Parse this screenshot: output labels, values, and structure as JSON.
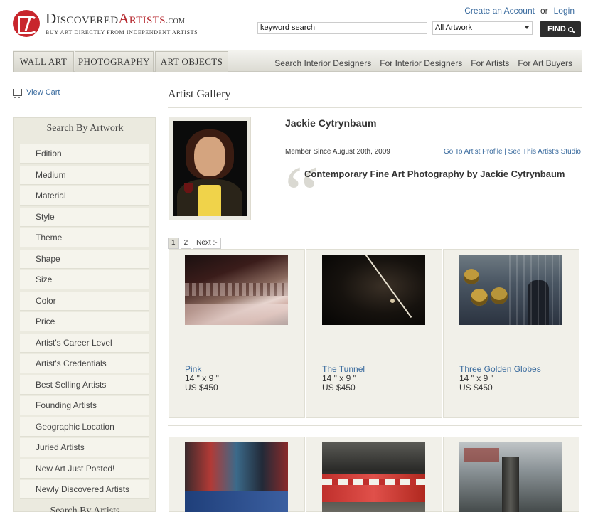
{
  "header": {
    "logo_prefix": "Discovered",
    "logo_accent": "Artists",
    "logo_suffix": ".com",
    "tagline": "BUY ART DIRECTLY FROM INDEPENDENT ARTISTS",
    "create_account": "Create an Account",
    "or": "or",
    "login": "Login",
    "search_value": "keyword search",
    "category_select": "All Artwork",
    "find_label": "FIND"
  },
  "nav": {
    "tabs": [
      "WALL ART",
      "PHOTOGRAPHY",
      "ART OBJECTS"
    ],
    "links": [
      "Search Interior Designers",
      "For Interior Designers",
      "For Artists",
      "For Art Buyers"
    ]
  },
  "sidebar": {
    "view_cart": "View Cart",
    "heading": "Search By Artwork",
    "items": [
      "Edition",
      "Medium",
      "Material",
      "Style",
      "Theme",
      "Shape",
      "Size",
      "Color",
      "Price",
      "Artist's Career Level",
      "Artist's Credentials",
      "Best Selling Artists",
      "Founding Artists",
      "Geographic Location",
      "Juried Artists",
      "New Art Just Posted!",
      "Newly Discovered Artists"
    ],
    "heading2": "Search By Artists"
  },
  "main": {
    "title": "Artist Gallery",
    "artist_name": "Jackie Cytrynbaum",
    "member_since": "Member Since August 20th, 2009",
    "profile_links": "Go To Artist Profile | See This Artist's Studio",
    "statement": "Contemporary Fine Art Photography by Jackie Cytrynbaum",
    "quote_mark": "“",
    "pager": [
      "1",
      "2",
      "Next :-"
    ],
    "artworks": [
      {
        "title": "Pink",
        "size": "14 \" x 9 \"",
        "price": "US $450"
      },
      {
        "title": "The Tunnel",
        "size": "14 \" x 9 \"",
        "price": "US $450"
      },
      {
        "title": "Three Golden Globes",
        "size": "14 \" x 9 \"",
        "price": "US $450"
      }
    ]
  }
}
